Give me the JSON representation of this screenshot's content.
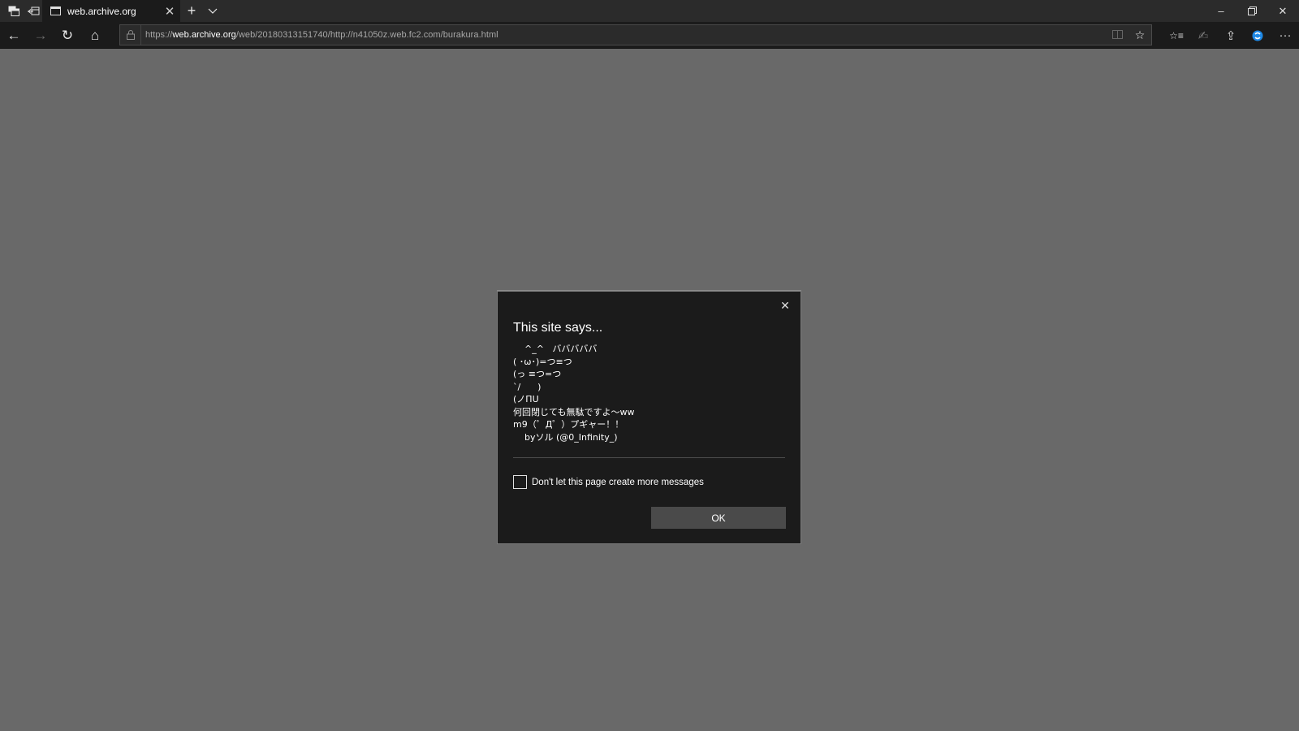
{
  "browser": {
    "tab": {
      "title": "web.archive.org",
      "favicon": "page-icon"
    },
    "tab_actions": {
      "new_tab": "+",
      "tab_list": "⌄"
    },
    "window_controls": {
      "minimize": "–",
      "restore": "❐",
      "close": "✕"
    },
    "nav": {
      "back": "←",
      "forward": "→",
      "refresh": "↻",
      "home": "⌂"
    },
    "address": {
      "scheme": "https://",
      "host": "web.archive.org",
      "path": "/web/20180313151740/http://n41050z.web.fc2.com/burakura.html"
    },
    "address_icons": {
      "reading_view": "▯▯",
      "favorite": "☆"
    },
    "toolbar": {
      "favorites_hub": "☆≡",
      "notes": "✍",
      "share": "⇪",
      "extension": "●",
      "more": "···"
    }
  },
  "dialog": {
    "title": "This site says...",
    "message": "    ^_^   バババババ\n( ･ω･)=つ≡つ\n(っ ≡つ=つ\n`/      )\n(ノΠU\n何回閉じても無駄ですよ～ww\nm9（゜Д゜）プギャー！！\n    byソル (@0_Infinity_)",
    "checkbox_label": "Don't let this page create more messages",
    "checkbox_checked": false,
    "ok_label": "OK",
    "close_glyph": "✕"
  }
}
